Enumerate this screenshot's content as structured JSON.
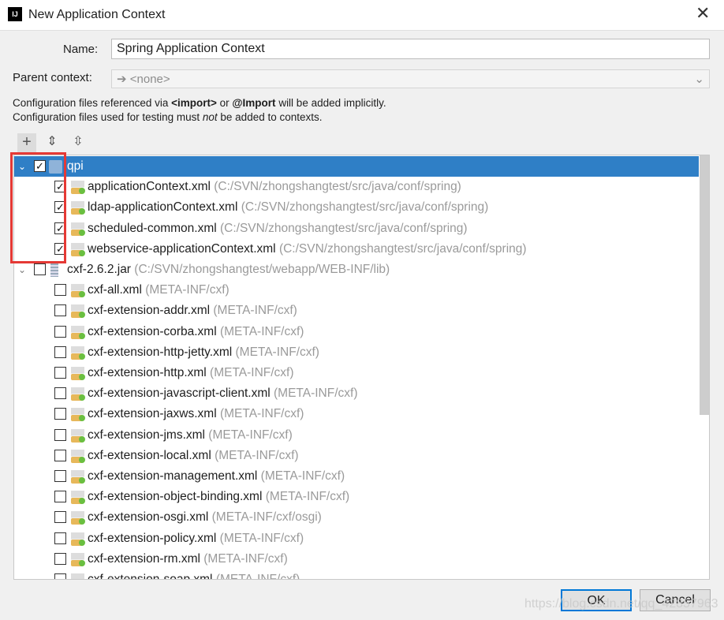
{
  "window": {
    "title": "New Application Context",
    "logo": "IJ"
  },
  "form": {
    "name_label": "Name:",
    "name_value": "Spring Application Context",
    "parent_label": "Parent context:",
    "parent_value": "<none>"
  },
  "info": {
    "line1_a": "Configuration files referenced via ",
    "line1_b": "<import>",
    "line1_c": " or ",
    "line1_d": "@Import",
    "line1_e": " will be added implicitly.",
    "line2_a": "Configuration files used for testing must ",
    "line2_b": "not",
    "line2_c": " be added to contexts."
  },
  "toolbar": {
    "add": "+",
    "expand": "expand-all-icon",
    "collapse": "collapse-all-icon"
  },
  "tree": [
    {
      "level": 0,
      "type": "folder",
      "label": "qpi",
      "path": "",
      "checked": true,
      "selected": true
    },
    {
      "level": 1,
      "type": "xml",
      "label": "applicationContext.xml",
      "path": "(C:/SVN/zhongshangtest/src/java/conf/spring)",
      "checked": true
    },
    {
      "level": 1,
      "type": "xml",
      "label": "ldap-applicationContext.xml",
      "path": "(C:/SVN/zhongshangtest/src/java/conf/spring)",
      "checked": true
    },
    {
      "level": 1,
      "type": "xml",
      "label": "scheduled-common.xml",
      "path": "(C:/SVN/zhongshangtest/src/java/conf/spring)",
      "checked": true
    },
    {
      "level": 1,
      "type": "xml",
      "label": "webservice-applicationContext.xml",
      "path": "(C:/SVN/zhongshangtest/src/java/conf/spring)",
      "checked": true
    },
    {
      "level": 0,
      "type": "jar",
      "label": "cxf-2.6.2.jar",
      "path": "(C:/SVN/zhongshangtest/webapp/WEB-INF/lib)",
      "checked": false
    },
    {
      "level": 1,
      "type": "xml",
      "label": "cxf-all.xml",
      "path": "(META-INF/cxf)",
      "checked": false
    },
    {
      "level": 1,
      "type": "xml",
      "label": "cxf-extension-addr.xml",
      "path": "(META-INF/cxf)",
      "checked": false
    },
    {
      "level": 1,
      "type": "xml",
      "label": "cxf-extension-corba.xml",
      "path": "(META-INF/cxf)",
      "checked": false
    },
    {
      "level": 1,
      "type": "xml",
      "label": "cxf-extension-http-jetty.xml",
      "path": "(META-INF/cxf)",
      "checked": false
    },
    {
      "level": 1,
      "type": "xml",
      "label": "cxf-extension-http.xml",
      "path": "(META-INF/cxf)",
      "checked": false
    },
    {
      "level": 1,
      "type": "xml",
      "label": "cxf-extension-javascript-client.xml",
      "path": "(META-INF/cxf)",
      "checked": false
    },
    {
      "level": 1,
      "type": "xml",
      "label": "cxf-extension-jaxws.xml",
      "path": "(META-INF/cxf)",
      "checked": false
    },
    {
      "level": 1,
      "type": "xml",
      "label": "cxf-extension-jms.xml",
      "path": "(META-INF/cxf)",
      "checked": false
    },
    {
      "level": 1,
      "type": "xml",
      "label": "cxf-extension-local.xml",
      "path": "(META-INF/cxf)",
      "checked": false
    },
    {
      "level": 1,
      "type": "xml",
      "label": "cxf-extension-management.xml",
      "path": "(META-INF/cxf)",
      "checked": false
    },
    {
      "level": 1,
      "type": "xml",
      "label": "cxf-extension-object-binding.xml",
      "path": "(META-INF/cxf)",
      "checked": false
    },
    {
      "level": 1,
      "type": "xml",
      "label": "cxf-extension-osgi.xml",
      "path": "(META-INF/cxf/osgi)",
      "checked": false
    },
    {
      "level": 1,
      "type": "xml",
      "label": "cxf-extension-policy.xml",
      "path": "(META-INF/cxf)",
      "checked": false
    },
    {
      "level": 1,
      "type": "xml",
      "label": "cxf-extension-rm.xml",
      "path": "(META-INF/cxf)",
      "checked": false
    },
    {
      "level": 1,
      "type": "xml",
      "label": "cxf-extension-soap.xml",
      "path": "(META-INF/cxf)",
      "checked": false
    }
  ],
  "buttons": {
    "ok": "OK",
    "cancel": "Cancel"
  },
  "watermark": "https://blog.csdn.net/qq_42857963",
  "colors": {
    "selection": "#2f7fc6",
    "highlight": "#e53935",
    "ok_border": "#0078d7"
  }
}
